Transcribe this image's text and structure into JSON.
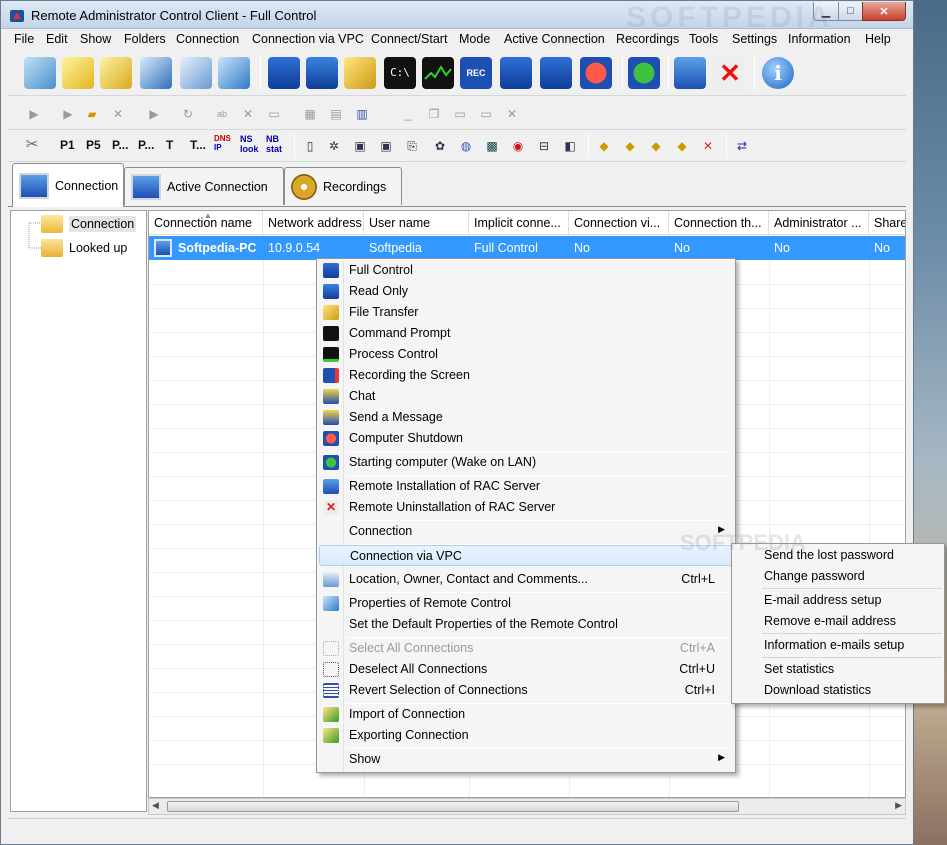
{
  "window": {
    "title": "Remote Administrator Control Client - Full Control",
    "watermark": "SOFTPEDIA",
    "watermark_mid": "SOFTPEDIA"
  },
  "menubar": [
    "File",
    "Edit",
    "Show",
    "Folders",
    "Connection",
    "Connection via VPC",
    "Connect/Start",
    "Mode",
    "Active Connection",
    "Recordings",
    "Tools",
    "Settings",
    "Information",
    "Help"
  ],
  "toolbar_main": [
    "connection-list-icon",
    "folder-open-icon",
    "search-folder-icon",
    "search-computer-icon",
    "properties-icon",
    "settings-icon",
    "full-control-icon",
    "read-only-icon",
    "file-transfer-icon",
    "command-prompt-icon",
    "process-control-icon",
    "recording-icon",
    "chat-icon",
    "send-message-icon",
    "shutdown-icon",
    "wake-on-lan-icon",
    "install-icon",
    "uninstall-icon",
    "info-icon"
  ],
  "toolbar_text": {
    "p1": "P1",
    "p5": "P5",
    "pdots": "P...",
    "pdots2": "P...",
    "t": "T",
    "tdots": "T...",
    "dns": "DNS",
    "ns": "NS",
    "nb": "NB",
    "look": "look",
    "stat": "stat",
    "ip": "IP"
  },
  "tabs": [
    {
      "label": "Connection",
      "active": true
    },
    {
      "label": "Active Connection",
      "active": false
    },
    {
      "label": "Recordings",
      "active": false
    }
  ],
  "tree": [
    {
      "label": "Connection"
    },
    {
      "label": "Looked up"
    }
  ],
  "table": {
    "columns": [
      "Connection name",
      "Network address",
      "User name",
      "Implicit conne...",
      "Connection vi...",
      "Connection th...",
      "Administrator ...",
      "Share"
    ],
    "rows": [
      [
        "Softpedia-PC",
        "10.9.0.54",
        "Softpedia",
        "Full Control",
        "No",
        "No",
        "No",
        "No"
      ]
    ]
  },
  "context_menu": [
    {
      "label": "Full Control",
      "icon": "full-control-icon"
    },
    {
      "label": "Read Only",
      "icon": "read-only-icon"
    },
    {
      "label": "File Transfer",
      "icon": "file-transfer-icon"
    },
    {
      "label": "Command Prompt",
      "icon": "command-prompt-icon"
    },
    {
      "label": "Process Control",
      "icon": "process-control-icon"
    },
    {
      "label": "Recording the Screen",
      "icon": "recording-icon"
    },
    {
      "label": "Chat",
      "icon": "chat-icon"
    },
    {
      "label": "Send a Message",
      "icon": "send-message-icon"
    },
    {
      "label": "Computer Shutdown",
      "icon": "shutdown-icon"
    },
    {
      "label": "Starting computer (Wake on LAN)",
      "icon": "wake-on-lan-icon"
    },
    {
      "label": "Remote Installation of RAC Server",
      "icon": "install-icon"
    },
    {
      "label": "Remote Uninstallation of RAC Server",
      "icon": "uninstall-icon"
    },
    {
      "label": "Connection",
      "submenu": true
    },
    {
      "label": "Connection via VPC",
      "highlighted": true
    },
    {
      "label": "Location, Owner, Contact and Comments...",
      "shortcut": "Ctrl+L",
      "icon": "location-icon"
    },
    {
      "label": "Properties of Remote Control",
      "icon": "properties-icon"
    },
    {
      "label": "Set the Default Properties of the Remote Control"
    },
    {
      "label": "Select All Connections",
      "shortcut": "Ctrl+A",
      "disabled": true,
      "icon": "select-all-icon"
    },
    {
      "label": "Deselect All Connections",
      "shortcut": "Ctrl+U",
      "icon": "deselect-icon"
    },
    {
      "label": "Revert Selection of Connections",
      "shortcut": "Ctrl+I",
      "icon": "revert-icon"
    },
    {
      "label": "Import of Connection",
      "icon": "import-icon"
    },
    {
      "label": "Exporting Connection",
      "icon": "export-icon"
    },
    {
      "label": "Show",
      "submenu": true
    }
  ],
  "submenu": [
    "Send the lost password",
    "Change password",
    "E-mail address setup",
    "Remove e-mail address",
    "Information e-mails setup",
    "Set statistics",
    "Download statistics"
  ]
}
